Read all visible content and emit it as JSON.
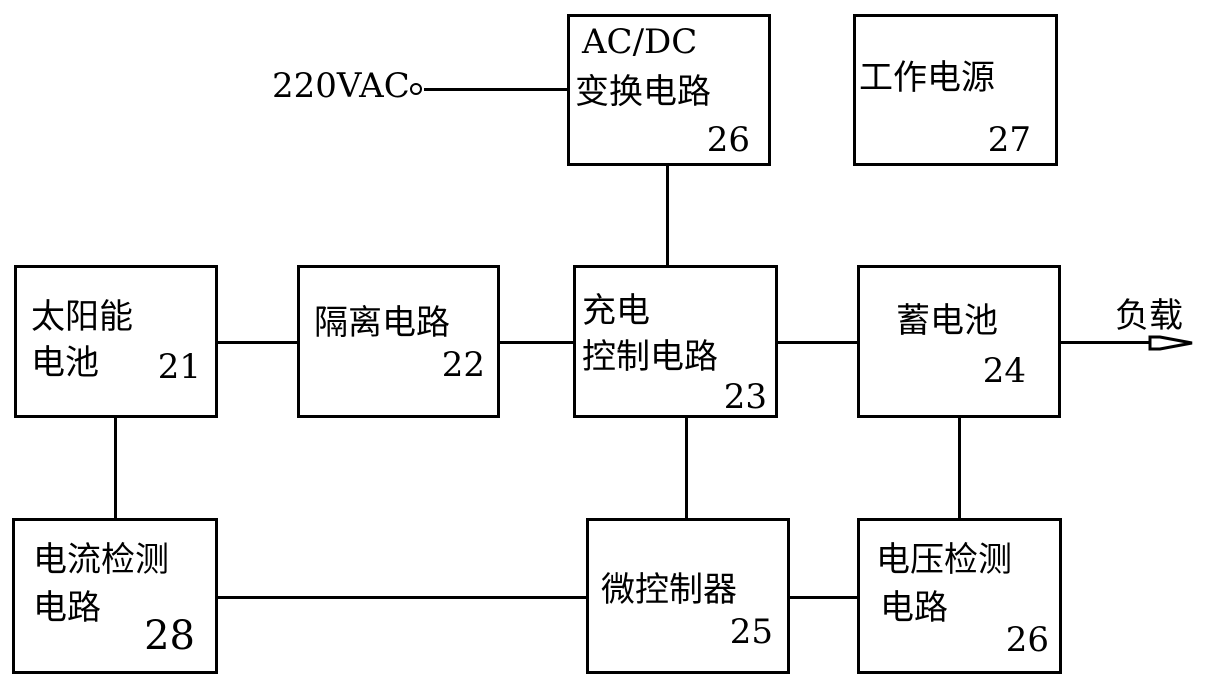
{
  "diagram": {
    "input": {
      "label": "220VAC"
    },
    "output": {
      "label": "负载"
    },
    "blocks": {
      "acdc": {
        "line1": "AC/DC",
        "line2": "变换电路",
        "id": "26"
      },
      "work_power": {
        "line1": "工作电源",
        "id": "27"
      },
      "solar": {
        "line1": "太阳能",
        "line2": "电池",
        "id": "21"
      },
      "isolation": {
        "line1": "隔离电路",
        "id": "22"
      },
      "charge_ctrl": {
        "line1": "充电",
        "line2": "控制电路",
        "id": "23"
      },
      "battery": {
        "line1": "蓄电池",
        "id": "24"
      },
      "current_detect": {
        "line1": "电流检测",
        "line2": "电路",
        "id": "28"
      },
      "mcu": {
        "line1": "微控制器",
        "id": "25"
      },
      "voltage_detect": {
        "line1": "电压检测",
        "line2": "电路",
        "id": "26"
      }
    },
    "connections": [
      [
        "220VAC",
        "acdc"
      ],
      [
        "acdc",
        "charge_ctrl"
      ],
      [
        "solar",
        "isolation"
      ],
      [
        "isolation",
        "charge_ctrl"
      ],
      [
        "charge_ctrl",
        "battery"
      ],
      [
        "battery",
        "负载"
      ],
      [
        "solar",
        "current_detect"
      ],
      [
        "charge_ctrl",
        "mcu"
      ],
      [
        "battery",
        "voltage_detect"
      ],
      [
        "current_detect",
        "mcu"
      ],
      [
        "mcu",
        "voltage_detect"
      ]
    ]
  }
}
